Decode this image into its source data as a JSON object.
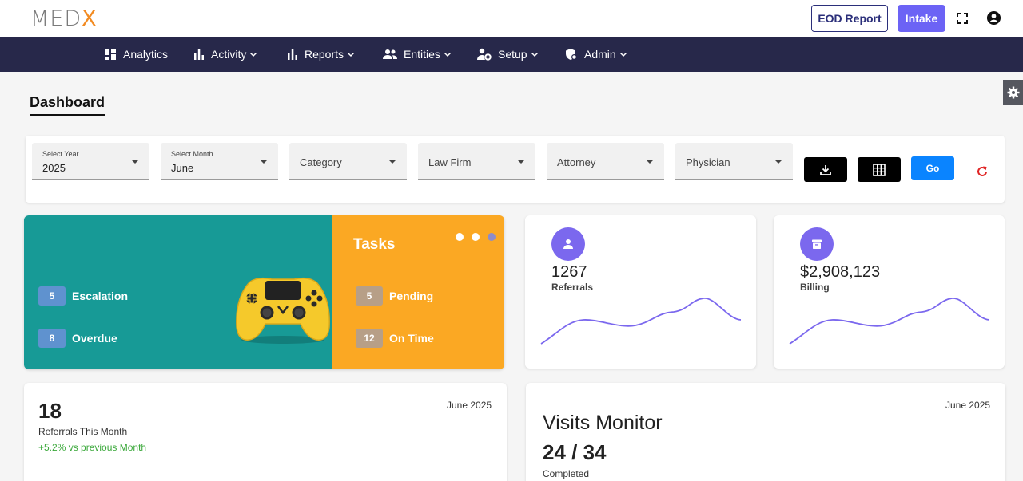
{
  "header": {
    "logo_left": "MED",
    "logo_right": "X",
    "eod_label": "EOD Report",
    "intake_label": "Intake"
  },
  "nav": {
    "items": [
      {
        "label": "Analytics",
        "icon": "dashboard-icon"
      },
      {
        "label": "Activity",
        "icon": "bar-chart-icon"
      },
      {
        "label": "Reports",
        "icon": "bar-chart-icon"
      },
      {
        "label": "Entities",
        "icon": "people-icon"
      },
      {
        "label": "Setup",
        "icon": "user-gear-icon"
      },
      {
        "label": "Admin",
        "icon": "shield-icon"
      }
    ]
  },
  "page": {
    "title": "Dashboard"
  },
  "filters": {
    "year": {
      "label": "Select Year",
      "value": "2025"
    },
    "month": {
      "label": "Select Month",
      "value": "June"
    },
    "category": "Category",
    "law_firm": "Law Firm",
    "attorney": "Attorney",
    "physician": "Physician",
    "go_label": "Go"
  },
  "tasks": {
    "title": "Tasks",
    "left": [
      {
        "count": "5",
        "label": "Escalation"
      },
      {
        "count": "8",
        "label": "Overdue"
      }
    ],
    "right": [
      {
        "count": "5",
        "label": "Pending"
      },
      {
        "count": "12",
        "label": "On Time"
      }
    ]
  },
  "stats": {
    "referrals": {
      "value": "1267",
      "label": "Referrals"
    },
    "billing": {
      "value": "$2,908,123",
      "label": "Billing"
    }
  },
  "referrals_month": {
    "count": "18",
    "label": "Referrals This Month",
    "trend": "+5.2% vs previous Month",
    "period": "June 2025"
  },
  "visits": {
    "title": "Visits Monitor",
    "count": "24 / 34",
    "label": "Completed",
    "period": "June 2025"
  },
  "colors": {
    "nav_bg": "#27284a",
    "accent": "#6c63f5",
    "teal": "#179a96",
    "orange": "#fba823",
    "go_blue": "#0a84ff",
    "trend_green": "#3aa83a"
  }
}
